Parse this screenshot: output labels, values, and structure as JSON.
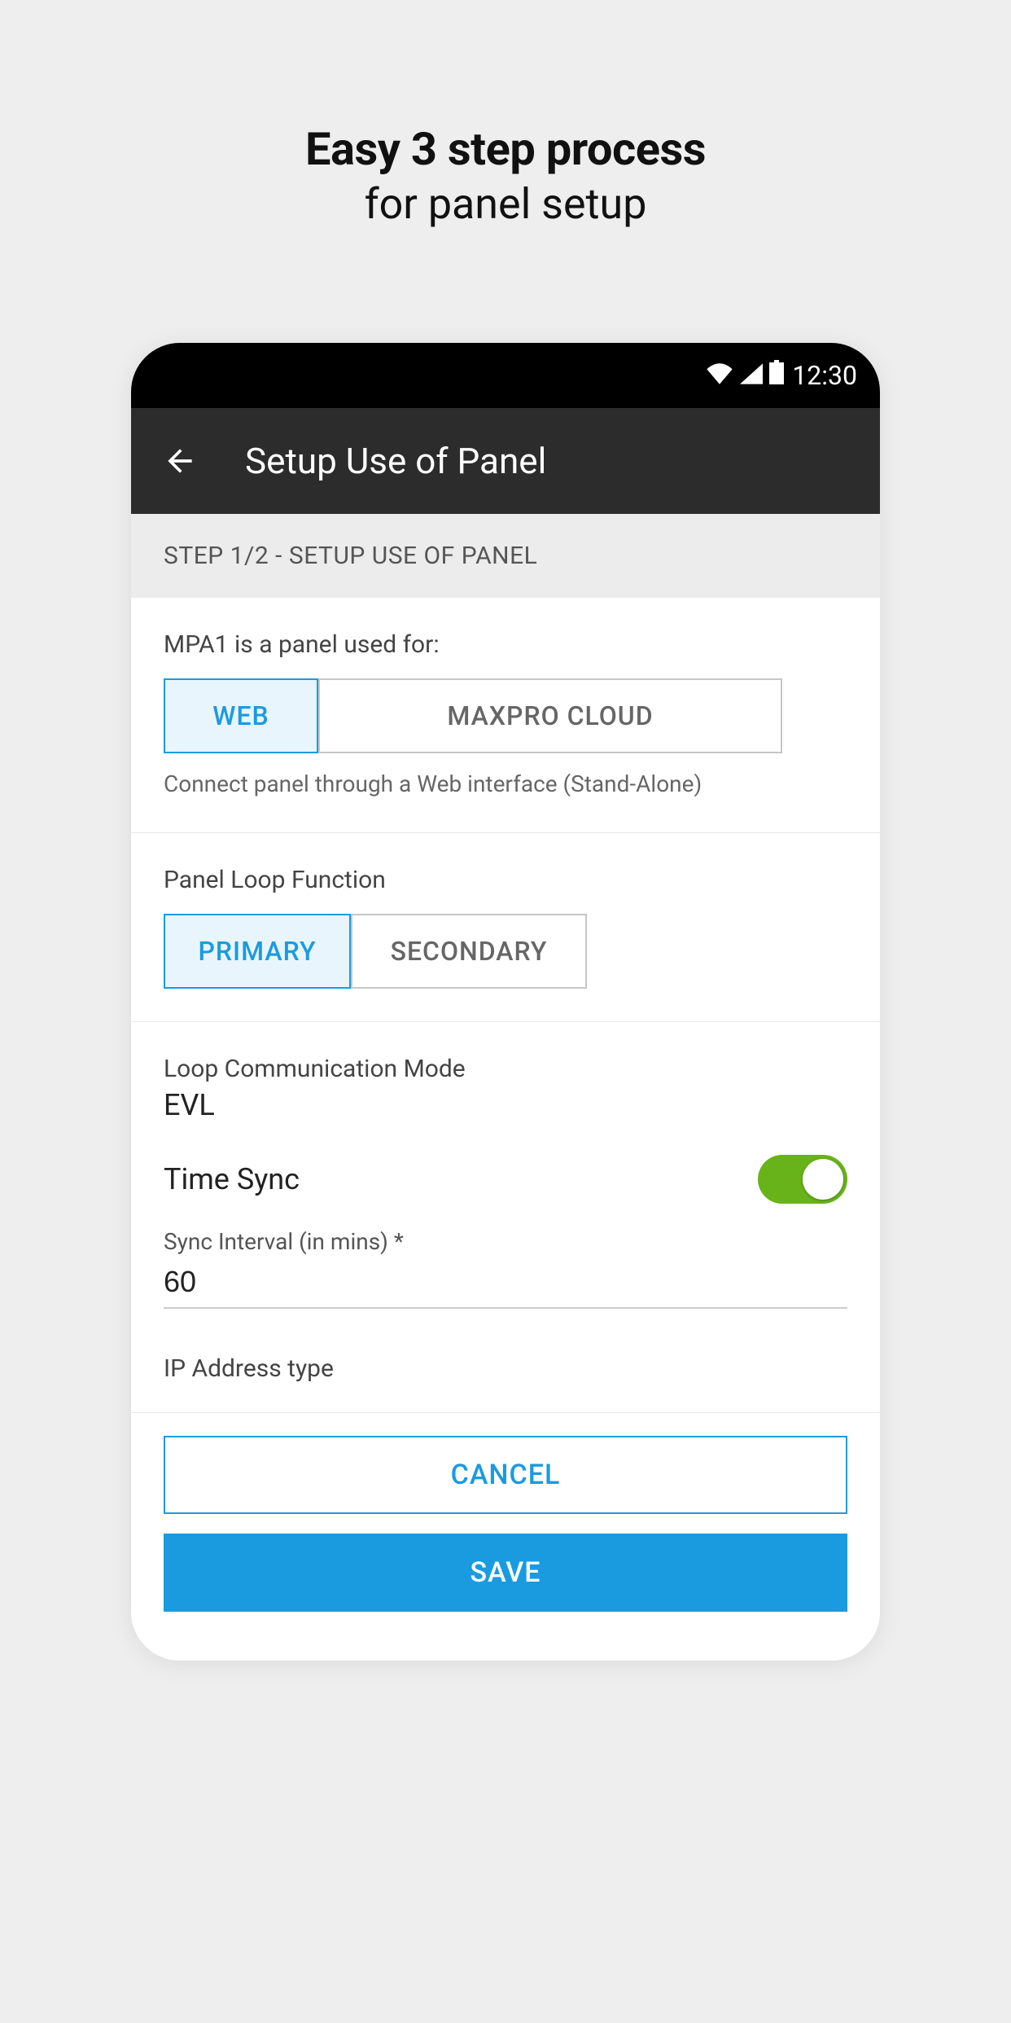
{
  "promo": {
    "line1": "Easy 3 step process",
    "line2": "for panel setup"
  },
  "status_bar": {
    "time": "12:30"
  },
  "app_bar": {
    "title": "Setup Use of Panel"
  },
  "step_header": "STEP 1/2 - SETUP USE OF PANEL",
  "panel_use": {
    "label": "MPA1 is a panel used for:",
    "options": [
      {
        "label": "WEB",
        "selected": true
      },
      {
        "label": "MAXPRO CLOUD",
        "selected": false
      }
    ],
    "hint": "Connect panel through a Web interface (Stand-Alone)"
  },
  "loop_function": {
    "label": "Panel Loop Function",
    "options": [
      {
        "label": "PRIMARY",
        "selected": true
      },
      {
        "label": "SECONDARY",
        "selected": false
      }
    ]
  },
  "loop_comm": {
    "label": "Loop Communication Mode",
    "value": "EVL"
  },
  "time_sync": {
    "label": "Time Sync",
    "enabled": true
  },
  "sync_interval": {
    "label": "Sync Interval (in mins) *",
    "value": "60"
  },
  "ip_address_type": {
    "label": "IP Address type"
  },
  "actions": {
    "cancel": "CANCEL",
    "save": "SAVE"
  },
  "colors": {
    "accent": "#1a9be0",
    "toggle_on": "#69b31a"
  }
}
